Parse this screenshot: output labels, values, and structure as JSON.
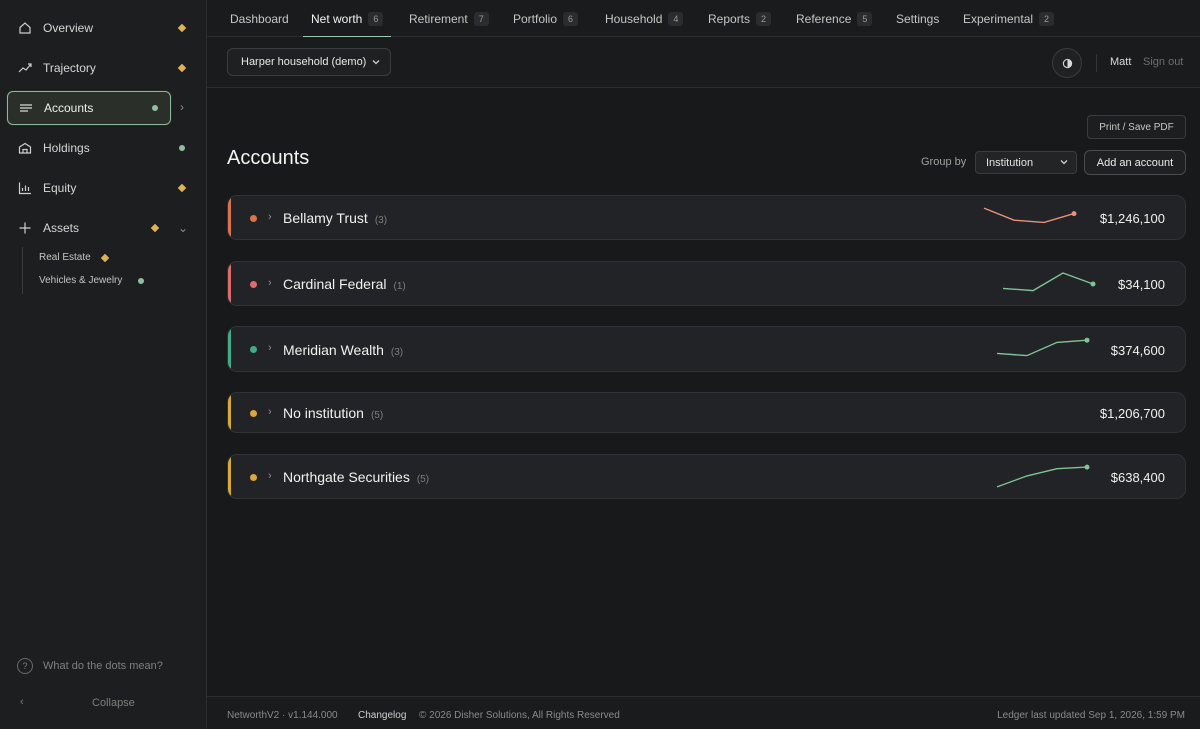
{
  "sidebar": {
    "items": [
      {
        "label": "Overview",
        "icon": "home-icon",
        "status": "diamond"
      },
      {
        "label": "Trajectory",
        "icon": "trend-icon",
        "status": "diamond"
      },
      {
        "label": "Accounts",
        "icon": "list-icon",
        "status": "dot"
      },
      {
        "label": "Holdings",
        "icon": "building-icon",
        "status": "dot"
      },
      {
        "label": "Equity",
        "icon": "bar-chart-icon",
        "status": "diamond"
      },
      {
        "label": "Assets",
        "icon": "plus-icon",
        "status": "diamond"
      }
    ],
    "sub_items": [
      {
        "label": "Real Estate",
        "status": "diamond"
      },
      {
        "label": "Vehicles & Jewelry",
        "status": "dot"
      }
    ],
    "help_label": "What do the dots mean?",
    "collapse_label": "Collapse"
  },
  "tabs": [
    {
      "label": "Dashboard",
      "badge": ""
    },
    {
      "label": "Net worth",
      "badge": "6"
    },
    {
      "label": "Retirement",
      "badge": "7"
    },
    {
      "label": "Portfolio",
      "badge": "6"
    },
    {
      "label": "Household",
      "badge": "4"
    },
    {
      "label": "Reports",
      "badge": "2"
    },
    {
      "label": "Reference",
      "badge": "5"
    },
    {
      "label": "Settings",
      "badge": ""
    },
    {
      "label": "Experimental",
      "badge": "2"
    }
  ],
  "header": {
    "household": "Harper household (demo)",
    "user": "Matt",
    "sign_out": "Sign out"
  },
  "main": {
    "print_label": "Print / Save PDF",
    "title": "Accounts",
    "group_by_label": "Group by",
    "group_by_value": "Institution",
    "add_label": "Add an account"
  },
  "accounts": [
    {
      "name": "Bellamy Trust",
      "count": "(3)",
      "amount": "$1,246,100",
      "color": "#e0724a",
      "dot": "#e0724a",
      "trend": [
        0.95,
        0.4,
        0.3,
        0.7
      ],
      "spark_color": "#e8907a"
    },
    {
      "name": "Cardinal Federal",
      "count": "(1)",
      "amount": "$34,100",
      "color": "#e06b6b",
      "dot": "#e06b6b",
      "trend": [
        0.3,
        0.2,
        1.0,
        0.5
      ],
      "spark_color": "#7fc495"
    },
    {
      "name": "Meridian Wealth",
      "count": "(3)",
      "amount": "$374,600",
      "color": "#3fae86",
      "dot": "#3fae86",
      "trend": [
        0.3,
        0.2,
        0.8,
        0.9
      ],
      "spark_color": "#7fc495"
    },
    {
      "name": "No institution",
      "count": "(5)",
      "amount": "$1,206,700",
      "color": "#d9a73a",
      "dot": "#d9a73a",
      "trend": [],
      "spark_color": ""
    },
    {
      "name": "Northgate Securities",
      "count": "(5)",
      "amount": "$638,400",
      "color": "#d9a73a",
      "dot": "#d9a73a",
      "trend": [
        0.05,
        0.55,
        0.88,
        0.95
      ],
      "spark_color": "#7fc495"
    }
  ],
  "footer": {
    "version": "NetworthV2 · v1.144.000",
    "changelog": "Changelog",
    "copyright": "© 2026 Disher Solutions, All Rights Reserved",
    "updated": "Ledger last updated Sep 1, 2026, 1:59 PM"
  },
  "colors": {
    "accent_active": "#8fb79a",
    "status_dot": "#8fbf9c",
    "status_diamond": "#e0b251"
  }
}
